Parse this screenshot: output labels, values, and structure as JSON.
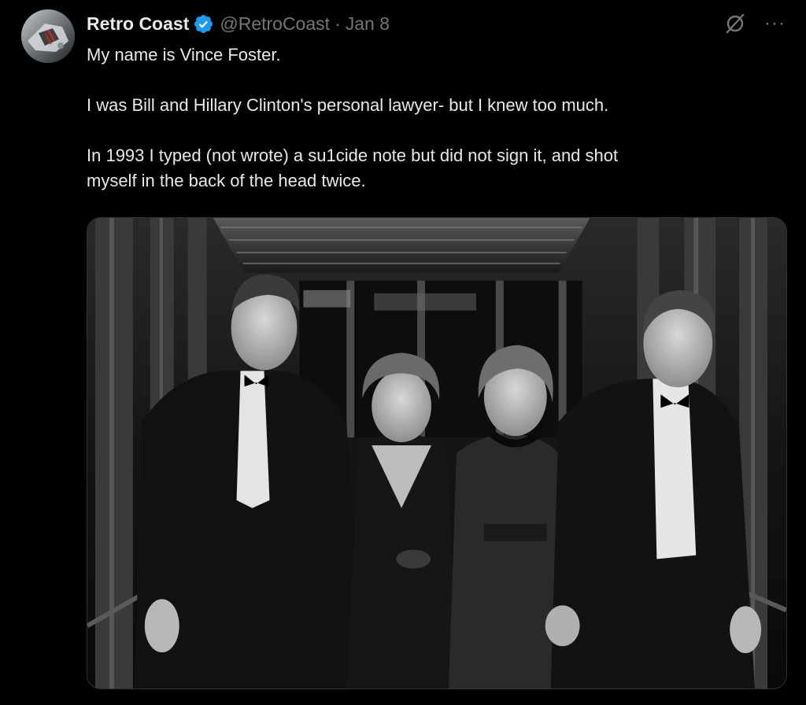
{
  "author": {
    "display_name": "Retro Coast",
    "handle": "@RetroCoast",
    "separator": "·",
    "date": "Jan 8",
    "verified": true,
    "verified_color": "#1d9bf0",
    "avatar_icon": "avatar-image"
  },
  "header_actions": {
    "grok_icon": "grok-icon",
    "more_label": "···"
  },
  "tweet": {
    "paragraphs": [
      "My name is Vince Foster.",
      "I was Bill and Hillary Clinton's personal lawyer- but I knew too much.",
      "In 1993 I typed (not wrote) a su1cide note but did not sign it, and shot\nmyself in the back of the head twice."
    ]
  },
  "media": {
    "type": "photo",
    "style": "black-and-white",
    "content": "four people in formal evening wear walking through a doorway"
  },
  "colors": {
    "background": "#000000",
    "text": "#e7e9ea",
    "secondary_text": "#71767b",
    "accent": "#1d9bf0"
  }
}
